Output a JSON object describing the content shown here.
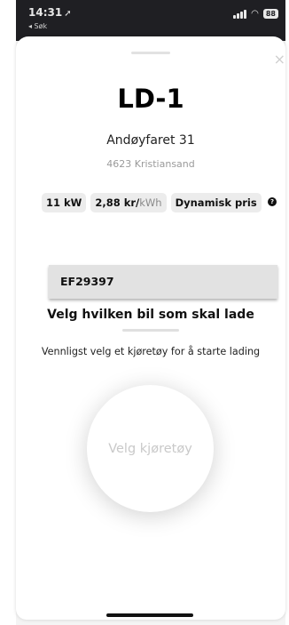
{
  "status_bar": {
    "time": "14:31",
    "location_glyph": "➚",
    "back_label": "◂ Søk",
    "battery": "88"
  },
  "charger": {
    "title": "LD-1",
    "address": "Andøyfaret 31",
    "postcode": "4623 Kristiansand",
    "power": "11 kW",
    "price_value": "2,88 kr/",
    "price_unit": "kWh",
    "pricing_type": "Dynamisk pris"
  },
  "vehicle_options": [
    "EF29397"
  ],
  "selection": {
    "heading": "Velg hvilken bil som skal lade",
    "instructions": "Vennligst velg et kjøretøy for å starte lading",
    "button_label": "Velg kjøretøy"
  },
  "icons": {
    "close": "×",
    "info": "?",
    "wifi": "◠"
  }
}
